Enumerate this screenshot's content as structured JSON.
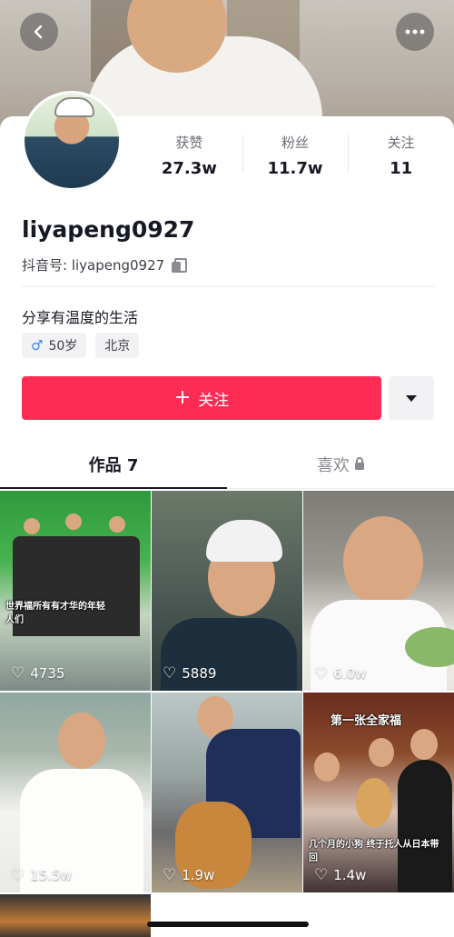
{
  "nav": {
    "back_icon": "back-icon",
    "more_icon": "more-icon"
  },
  "profile": {
    "username": "liyapeng0927",
    "douyin_id": "抖音号: liyapeng0927",
    "bio": "分享有温度的生活",
    "age_tag": "50岁",
    "location_tag": "北京"
  },
  "stats": [
    {
      "label": "获赞",
      "value": "27.3w"
    },
    {
      "label": "粉丝",
      "value": "11.7w"
    },
    {
      "label": "关注",
      "value": "11"
    }
  ],
  "actions": {
    "follow_label": "关注",
    "follow_plus": "+"
  },
  "tabs": {
    "works": "作品 7",
    "likes": "喜欢"
  },
  "videos": [
    {
      "likes": "4735",
      "caption": "世界福所有有才华的年轻人们"
    },
    {
      "likes": "5889"
    },
    {
      "likes": "6.0w"
    },
    {
      "likes": "15.5w"
    },
    {
      "likes": "1.9w"
    },
    {
      "likes": "1.4w",
      "caption_top": "第一张全家福",
      "caption_bottom": "几个月的小狗 终于托人从日本带回"
    }
  ],
  "colors": {
    "accent": "#fe2c55",
    "male": "#3b87f5"
  }
}
